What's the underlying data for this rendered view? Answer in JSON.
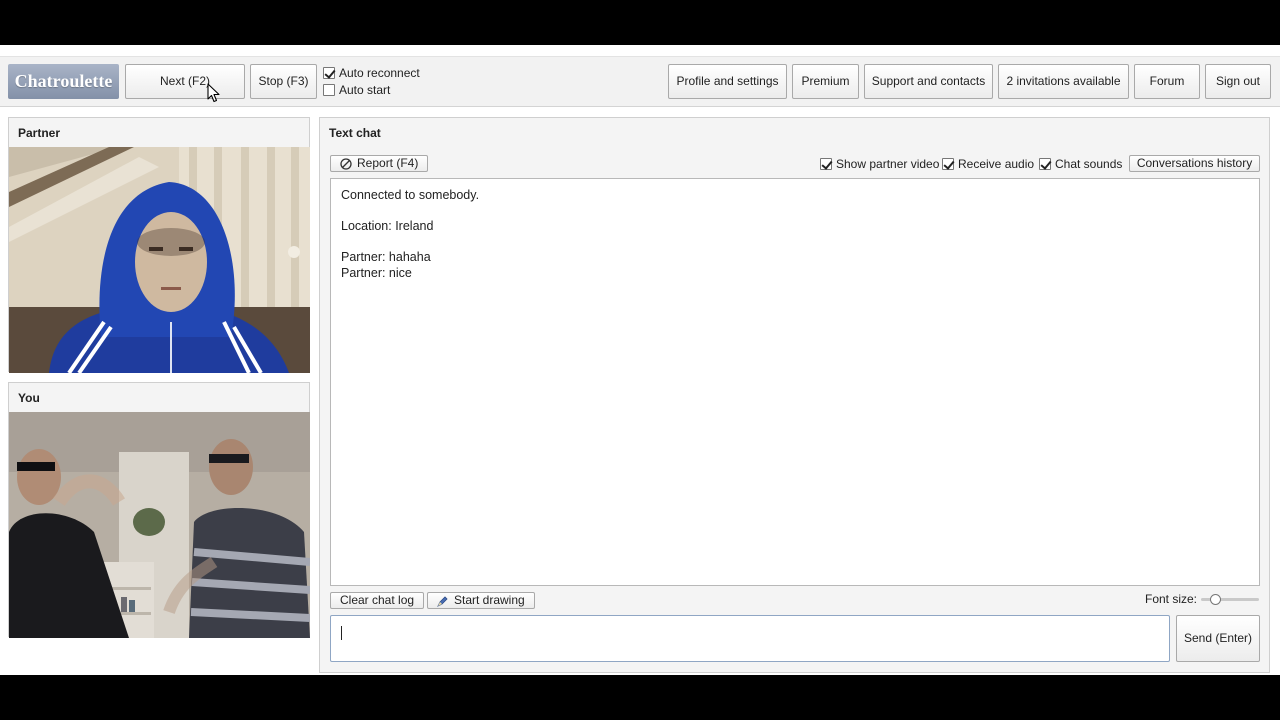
{
  "app": {
    "logo": "Chatroulette"
  },
  "toolbar": {
    "next_label": "Next (F2)",
    "stop_label": "Stop (F3)",
    "auto_reconnect_label": "Auto reconnect",
    "auto_reconnect_checked": true,
    "auto_start_label": "Auto start",
    "auto_start_checked": false,
    "profile_label": "Profile and settings",
    "premium_label": "Premium",
    "support_label": "Support and contacts",
    "invitations_label": "2 invitations available",
    "forum_label": "Forum",
    "signout_label": "Sign out"
  },
  "partner_panel": {
    "title": "Partner"
  },
  "you_panel": {
    "title": "You"
  },
  "chat": {
    "title": "Text chat",
    "report_label": "Report (F4)",
    "show_partner_video_label": "Show partner video",
    "show_partner_video_checked": true,
    "receive_audio_label": "Receive audio",
    "receive_audio_checked": true,
    "chat_sounds_label": "Chat sounds",
    "chat_sounds_checked": true,
    "history_label": "Conversations history",
    "log": {
      "connected": "Connected to somebody.",
      "location": "Location: Ireland",
      "messages": [
        "Partner: hahaha",
        "Partner: nice"
      ]
    },
    "clear_label": "Clear chat log",
    "drawing_label": "Start drawing",
    "font_size_label": "Font size:",
    "input_value": "",
    "send_label": "Send (Enter)"
  }
}
